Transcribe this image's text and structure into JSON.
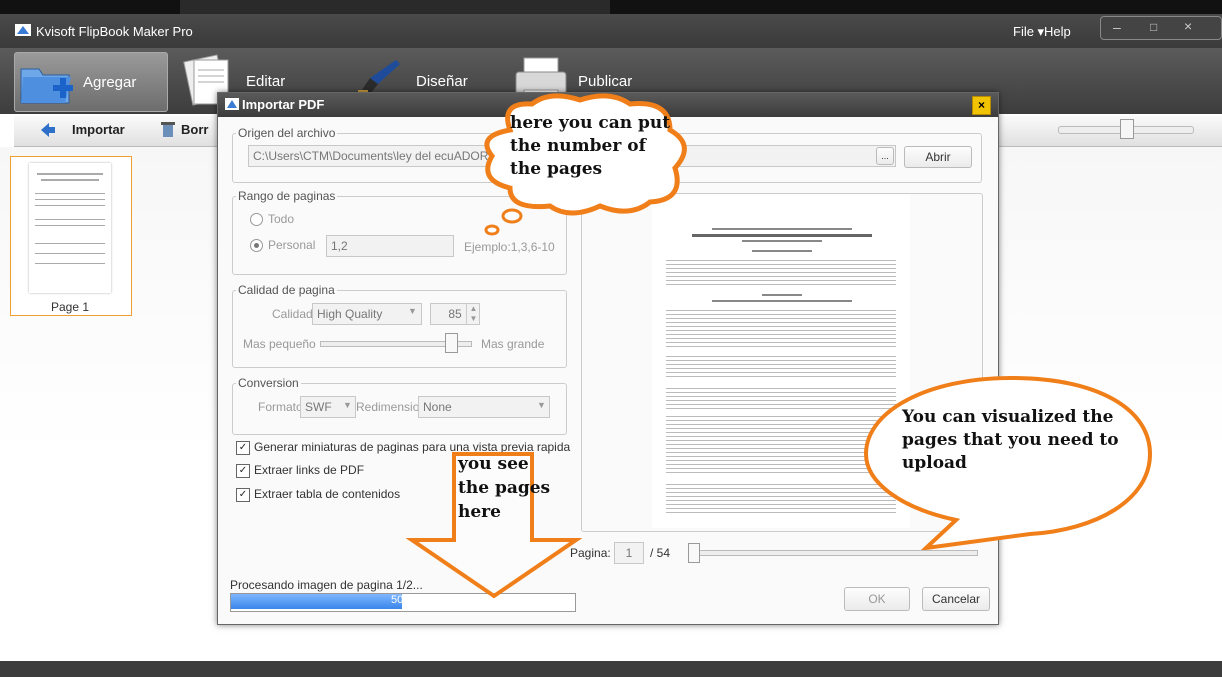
{
  "app": {
    "title": "Kvisoft FlipBook Maker Pro",
    "menu": [
      "File ▾",
      "Help"
    ]
  },
  "main_tabs": [
    {
      "label": "Agregar",
      "icon": "folder-add-icon"
    },
    {
      "label": "Editar",
      "icon": "documents-icon"
    },
    {
      "label": "Diseñar",
      "icon": "brush-icon"
    },
    {
      "label": "Publicar",
      "icon": "printer-icon"
    }
  ],
  "subtoolbar": {
    "importar": "Importar",
    "borrar": "Borr"
  },
  "thumbnails": [
    {
      "label": "Page 1"
    }
  ],
  "dialog": {
    "title": "Importar PDF",
    "close": "×",
    "origen": {
      "legend": "Origen del archivo",
      "path": "C:\\Users\\CTM\\Documents\\ley del ecuADOR.pd",
      "browse": "...",
      "abrir": "Abrir"
    },
    "rango": {
      "legend": "Rango de paginas",
      "todo": "Todo",
      "personal": "Personal",
      "personal_value": "1,2",
      "ejemplo": "Ejemplo:1,3,6-10"
    },
    "calidad": {
      "legend": "Calidad de pagina",
      "calidad_label": "Calidad",
      "calidad_value": "High Quality",
      "number": "85",
      "small": "Mas pequeño",
      "large": "Mas grande",
      "slider_level": 0.85
    },
    "conversion": {
      "legend": "Conversion",
      "formato_label": "Formato",
      "formato_value": "SWF",
      "redim_label": "Redimension",
      "redim_value": "None"
    },
    "checks": [
      "Generar miniaturas de paginas para una vista previa rapida",
      "Extraer links de PDF",
      "Extraer tabla de contenidos"
    ],
    "pagina_label": "Pagina:",
    "pagina_value": "1",
    "pagina_total": "/ 54",
    "status": "Procesando imagen de pagina 1/2...",
    "progress_text": "50%",
    "progress": 0.5,
    "ok": "OK",
    "cancel": "Cancelar"
  },
  "callouts": {
    "pages_number": "here you can put the number of the pages",
    "visualize": "You can visualized the pages that you need to upload",
    "see_pages": "you see the pages here"
  },
  "colors": {
    "accent": "#f07f1a",
    "progress": "#3a86ea",
    "close": "#f2c300"
  }
}
